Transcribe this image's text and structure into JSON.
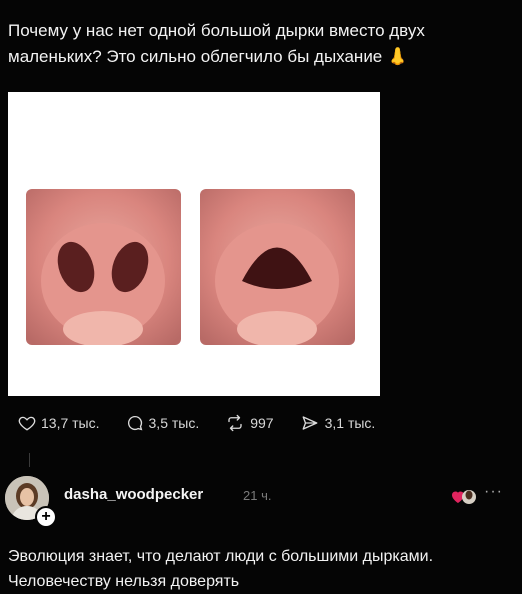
{
  "post": {
    "text": "Почему у нас нет одной большой дырки вместо двух маленьких? Это сильно облегчило бы дыхание 👃"
  },
  "actions": {
    "likes": "13,7 тыс.",
    "comments": "3,5 тыс.",
    "reposts": "997",
    "shares": "3,1 тыс."
  },
  "reply": {
    "username": "dasha_woodpecker",
    "time": "21 ч.",
    "more": "···",
    "text": "Эволюция знает, что делают люди с большими дырками. Человечеству нельзя доверять"
  },
  "icons": [
    "heart-icon",
    "comment-icon",
    "repost-icon",
    "share-icon",
    "add-follow-icon",
    "reaction-icon",
    "more-icon"
  ],
  "colors": {
    "background": "#050505",
    "text": "#f2f2f2",
    "muted": "#7b7b7b"
  }
}
